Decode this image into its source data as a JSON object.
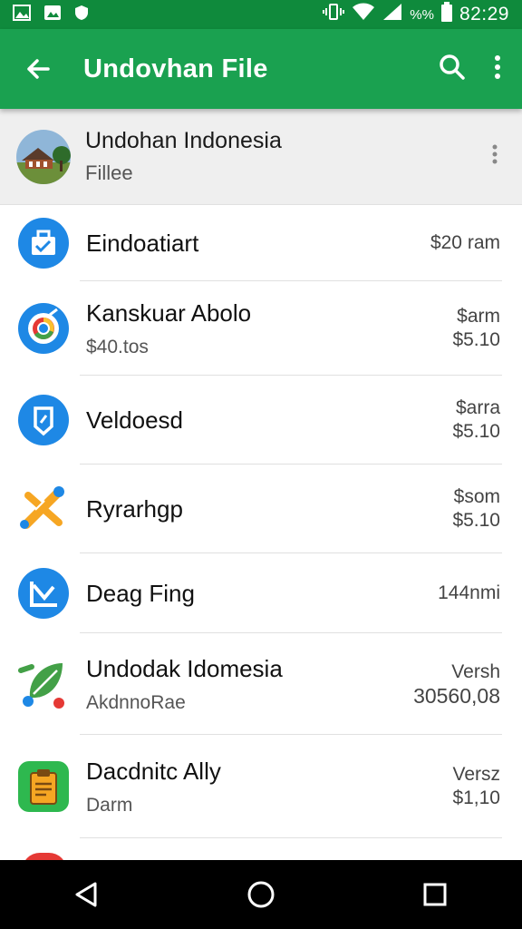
{
  "status_bar": {
    "time": "82:29",
    "battery_pct": "%%"
  },
  "app_bar": {
    "title": "Undovhan File",
    "back_icon": "arrow-back-icon",
    "search_icon": "search-icon",
    "overflow_icon": "more-vert-icon"
  },
  "header": {
    "title": "Undohan Indonesia",
    "subtitle": "Fillee"
  },
  "items": [
    {
      "primary": "Eindoatiart",
      "secondary": "",
      "meta1": "$20 ram",
      "meta2": "",
      "icon": "briefcase-icon",
      "color": "#1e88e5"
    },
    {
      "primary": "Kanskuar Abolo",
      "secondary": "$40.tos",
      "meta1": "$arm",
      "meta2": "$5.10",
      "icon": "chrome-icon",
      "color": "#1e88e5"
    },
    {
      "primary": "Veldoesd",
      "secondary": "",
      "meta1": "$arra",
      "meta2": "$5.10",
      "icon": "shield-note-icon",
      "color": "#1e88e5"
    },
    {
      "primary": "Ryrarhgp",
      "secondary": "",
      "meta1": "$som",
      "meta2": "$5.10",
      "icon": "tools-icon",
      "color": "#f6a623"
    },
    {
      "primary": "Deag Fing",
      "secondary": "",
      "meta1": "144nmi",
      "meta2": "",
      "icon": "chart-icon",
      "color": "#1e88e5"
    },
    {
      "primary": "Undodak Idomesia",
      "secondary": "AkdnnoRae",
      "meta1": "Versh",
      "meta2": "30560,08",
      "icon": "leaf-icon",
      "color": "#43a047"
    },
    {
      "primary": "Dacdnitc Ally",
      "secondary": "Darm",
      "meta1": "Versz",
      "meta2": "$1,10",
      "icon": "clipboard-icon",
      "color": "#2eb84f"
    }
  ]
}
